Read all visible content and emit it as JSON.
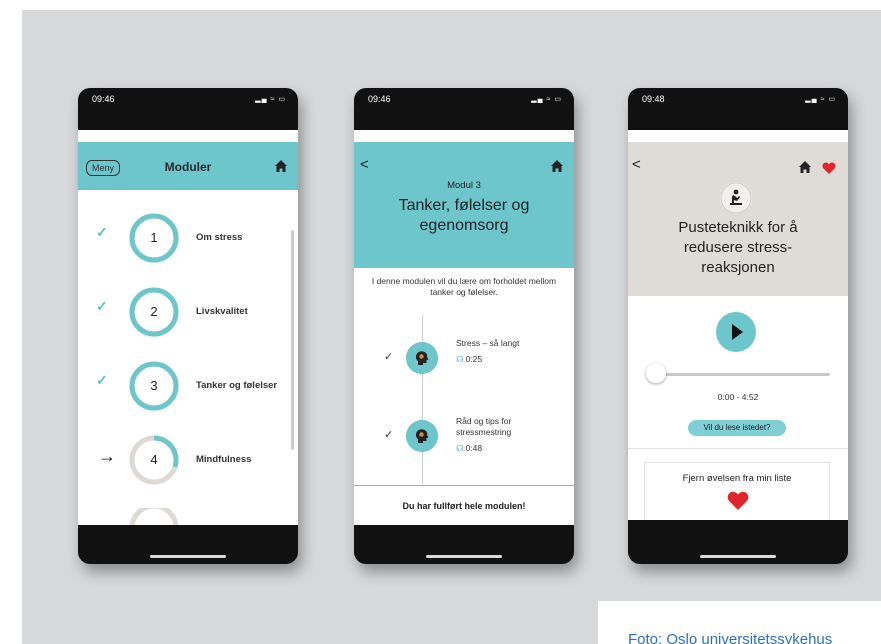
{
  "phone1": {
    "time": "09:46",
    "indicators": "▂▄ ≈ ▭",
    "menu_label": "Meny",
    "title": "Moduler",
    "modules": [
      {
        "number": "1",
        "label": "Om stress",
        "state": "done",
        "progress": 1.0
      },
      {
        "number": "2",
        "label": "Livskvalitet",
        "state": "done",
        "progress": 1.0
      },
      {
        "number": "3",
        "label": "Tanker og følelser",
        "state": "done",
        "progress": 1.0
      },
      {
        "number": "4",
        "label": "Mindfulness",
        "state": "current",
        "progress": 0.3
      }
    ],
    "check_glyph": "✓",
    "current_glyph": "→",
    "accent": "#6cc6cc"
  },
  "phone2": {
    "time": "09:46",
    "indicators": "▂▄ ≈ ▭",
    "back_glyph": "<",
    "module_kicker": "Modul 3",
    "title_line1": "Tanker, følelser og",
    "title_line2": "egenomsorg",
    "intro": "I denne modulen vil du lære om forholdet mellom tanker og følelser.",
    "lessons": [
      {
        "title_line1": "Stress – så langt",
        "title_line2": "",
        "duration": "0:25"
      },
      {
        "title_line1": "Råd og tips for",
        "title_line2": "stressmestring",
        "duration": "0:48"
      }
    ],
    "check_glyph": "✓",
    "headphones_glyph": "🎧",
    "footer": "Du har fullført hele modulen!"
  },
  "phone3": {
    "time": "09:48",
    "indicators": "▂▄ ≈ ▭",
    "back_glyph": "<",
    "title_line1": "Pusteteknikk for å",
    "title_line2": "redusere stress-",
    "title_line3": "reaksjonen",
    "progress": 0.0,
    "time_display": "0:00 - 4:52",
    "read_instead": "Vil du lese istedet?",
    "remove_label": "Fjern øvelsen fra min liste",
    "heart_color": "#e0262b",
    "gray_bg": "#dfdcd8"
  },
  "credit": "Foto: Oslo universitetssykehus"
}
